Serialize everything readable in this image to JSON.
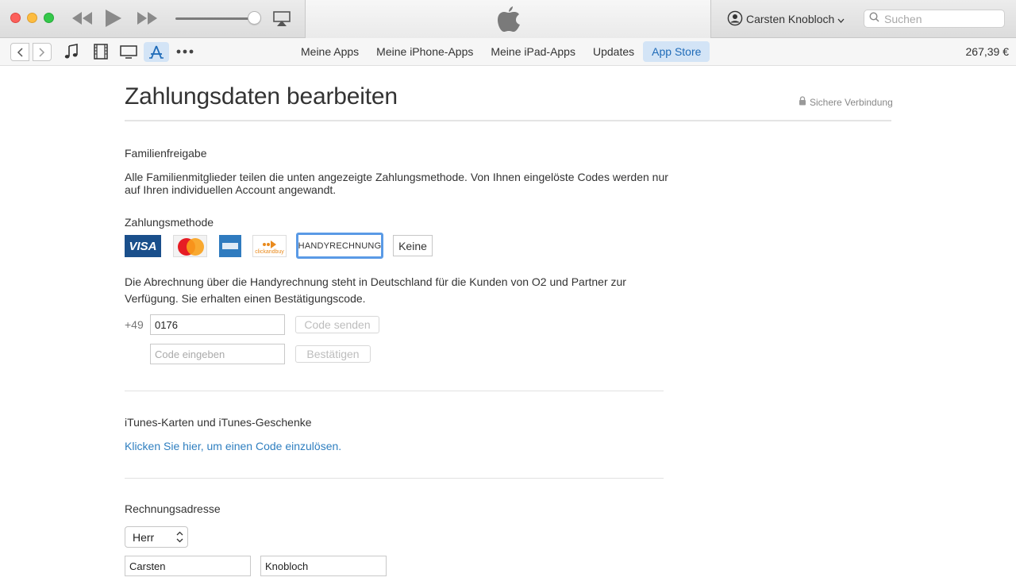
{
  "window": {
    "account_name": "Carsten Knobloch",
    "search_placeholder": "Suchen"
  },
  "navbar": {
    "tabs": [
      {
        "label": "Meine Apps",
        "active": false
      },
      {
        "label": "Meine iPhone-Apps",
        "active": false
      },
      {
        "label": "Meine iPad-Apps",
        "active": false
      },
      {
        "label": "Updates",
        "active": false
      },
      {
        "label": "App Store",
        "active": true
      }
    ],
    "balance": "267,39 €",
    "media_icons": [
      "music-icon",
      "movie-icon",
      "tv-icon",
      "app-store-icon",
      "more-icon"
    ]
  },
  "page": {
    "title": "Zahlungsdaten bearbeiten",
    "secure_label": "Sichere Verbindung"
  },
  "family": {
    "heading": "Familienfreigabe",
    "text": "Alle Familienmitglieder teilen die unten angezeigte Zahlungsmethode. Von Ihnen eingelöste Codes werden nur auf Ihren individuellen Account angewandt."
  },
  "payment": {
    "heading": "Zahlungsmethode",
    "visa_label": "VISA",
    "mastercard_label": "MasterCard",
    "clickandbuy_label": "clickandbuy",
    "selected_label": "HANDYRECHNUNG",
    "none_label": "Keine",
    "info": "Die Abrechnung über die Handyrechnung steht in Deutschland für die Kunden von O2 und Partner zur Verfügung. Sie erhalten einen Bestätigungscode.",
    "country_prefix": "+49",
    "phone_value": "0176",
    "send_code_label": "Code senden",
    "code_placeholder": "Code eingeben",
    "confirm_label": "Bestätigen"
  },
  "gift": {
    "heading": "iTunes-Karten und iTunes-Geschenke",
    "link": "Klicken Sie hier, um einen Code einzulösen."
  },
  "billing": {
    "heading": "Rechnungsadresse",
    "salutation": "Herr",
    "first_name": "Carsten",
    "last_name": "Knobloch"
  },
  "colors": {
    "accent": "#1f6bb8",
    "link": "#2f7fc0",
    "selection_border": "#5a9ae6",
    "active_tab_bg": "#d3e4f6"
  }
}
